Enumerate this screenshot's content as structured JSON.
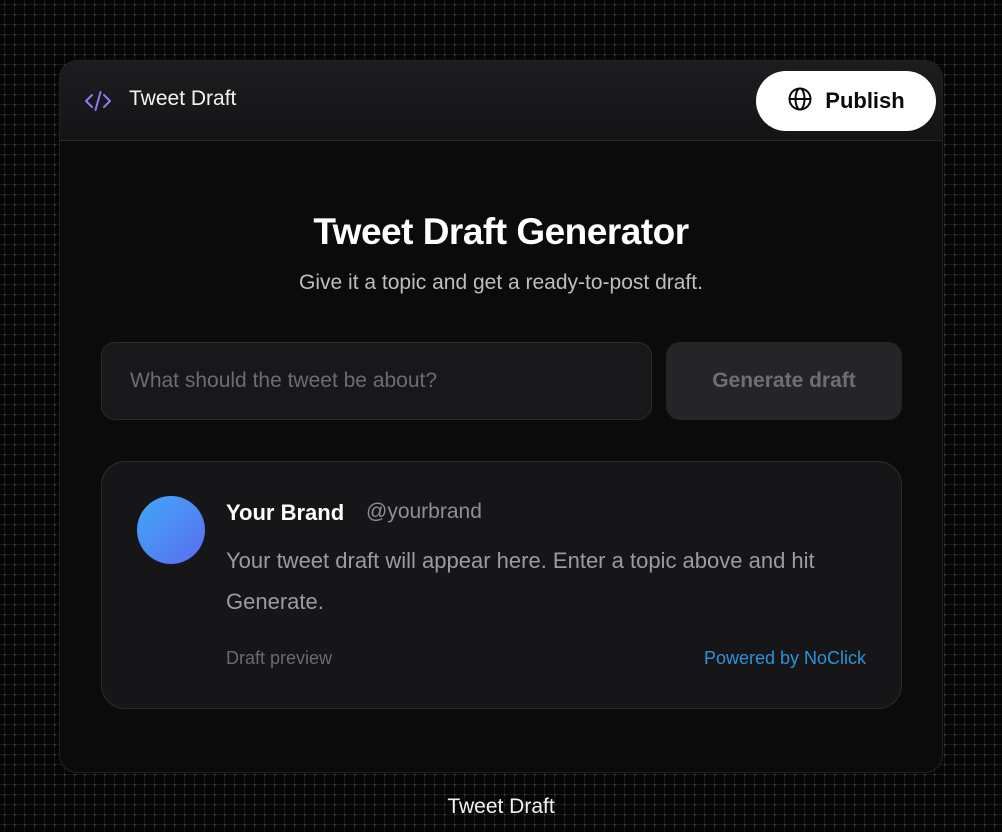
{
  "window": {
    "title": "Tweet Draft",
    "publish_label": "Publish"
  },
  "main": {
    "title": "Tweet Draft Generator",
    "subtitle": "Give it a topic and get a ready-to-post draft.",
    "topic_placeholder": "What should the tweet be about?",
    "topic_value": "",
    "generate_label": "Generate draft"
  },
  "tweet": {
    "brand_name": "Your Brand",
    "handle": "@yourbrand",
    "body": "Your tweet draft will appear here. Enter a topic above and hit Generate.",
    "footer_left": "Draft preview",
    "footer_right": "Powered by NoClick"
  },
  "footer": {
    "label": "Tweet Draft"
  },
  "icons": {
    "app_icon": "code-icon",
    "publish_icon": "globe-icon"
  },
  "colors": {
    "accent_icon": "#8b7cf6",
    "link": "#2b93d8",
    "avatar_start": "#40a8f8",
    "avatar_end": "#5b6cf0"
  }
}
